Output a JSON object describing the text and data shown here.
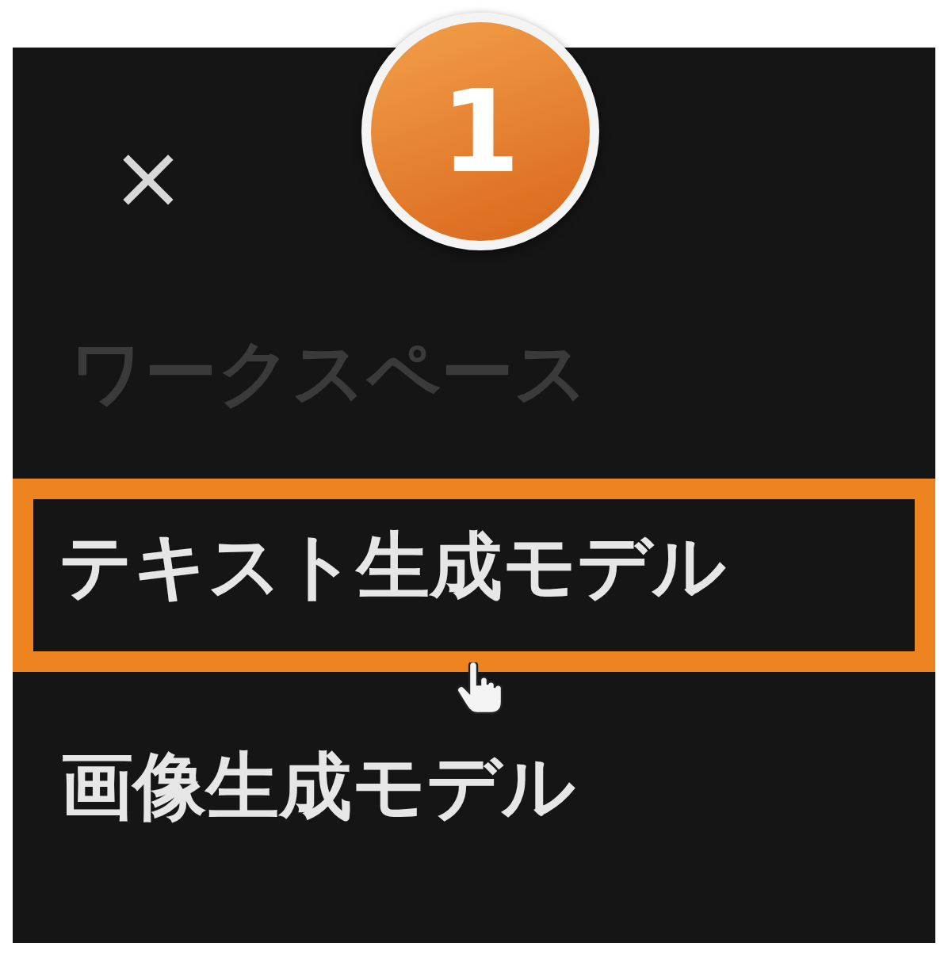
{
  "close_button": "×",
  "step_badge": "1",
  "menu": [
    {
      "label": "ワークスペース",
      "kind": "header",
      "selected": false
    },
    {
      "label": "テキスト生成モデル",
      "kind": "item",
      "selected": true
    },
    {
      "label": "画像生成モデル",
      "kind": "item",
      "selected": false
    }
  ],
  "cursor": {
    "kind": "hand"
  }
}
